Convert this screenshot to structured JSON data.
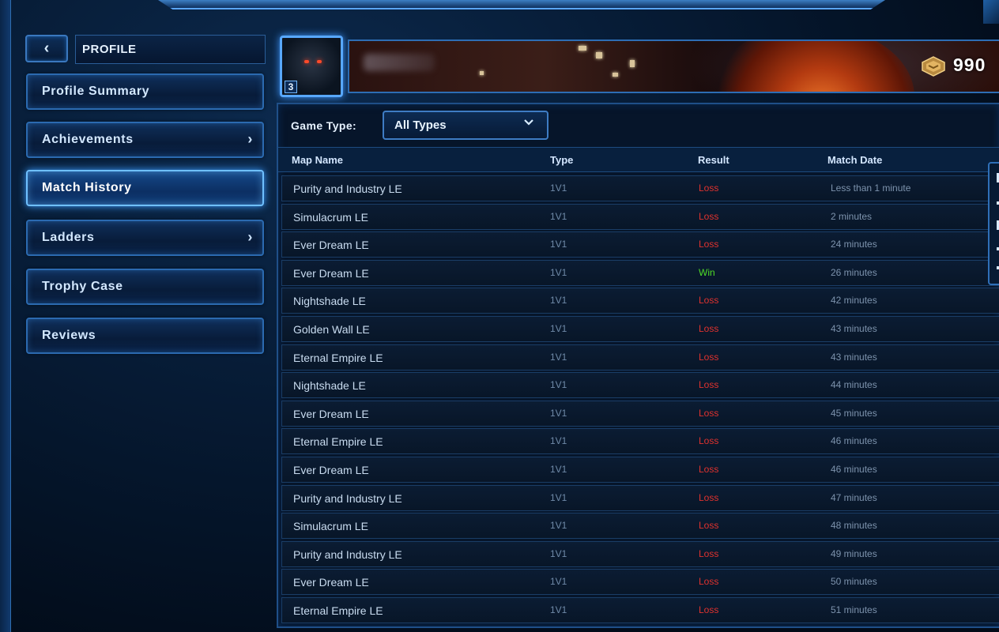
{
  "sidebar": {
    "back_icon": "chevron-left-icon",
    "title": "PROFILE",
    "items": [
      {
        "label": "Profile Summary",
        "has_chevron": false
      },
      {
        "label": "Achievements",
        "has_chevron": true
      },
      {
        "label": "Match History",
        "has_chevron": false,
        "active": true
      },
      {
        "label": "Ladders",
        "has_chevron": true
      },
      {
        "label": "Trophy Case",
        "has_chevron": false
      },
      {
        "label": "Reviews",
        "has_chevron": false
      }
    ],
    "chevron_glyph": "›"
  },
  "header": {
    "portrait_level": "3",
    "points": "990"
  },
  "filter": {
    "label": "Game Type:",
    "selected": "All Types",
    "chevron_glyph": "⌄"
  },
  "table": {
    "columns": [
      "Map Name",
      "Type",
      "Result",
      "Match Date"
    ],
    "rows": [
      {
        "map": "Purity and Industry LE",
        "type": "1V1",
        "result": "Loss",
        "date": "Less than 1 minute"
      },
      {
        "map": "Simulacrum LE",
        "type": "1V1",
        "result": "Loss",
        "date": "2 minutes"
      },
      {
        "map": "Ever Dream LE",
        "type": "1V1",
        "result": "Loss",
        "date": "24 minutes"
      },
      {
        "map": "Ever Dream LE",
        "type": "1V1",
        "result": "Win",
        "date": "26 minutes"
      },
      {
        "map": "Nightshade LE",
        "type": "1V1",
        "result": "Loss",
        "date": "42 minutes"
      },
      {
        "map": "Golden Wall LE",
        "type": "1V1",
        "result": "Loss",
        "date": "43 minutes"
      },
      {
        "map": "Eternal Empire LE",
        "type": "1V1",
        "result": "Loss",
        "date": "43 minutes"
      },
      {
        "map": "Nightshade LE",
        "type": "1V1",
        "result": "Loss",
        "date": "44 minutes"
      },
      {
        "map": "Ever Dream LE",
        "type": "1V1",
        "result": "Loss",
        "date": "45 minutes"
      },
      {
        "map": "Eternal Empire LE",
        "type": "1V1",
        "result": "Loss",
        "date": "46 minutes"
      },
      {
        "map": "Ever Dream LE",
        "type": "1V1",
        "result": "Loss",
        "date": "46 minutes"
      },
      {
        "map": "Purity and Industry LE",
        "type": "1V1",
        "result": "Loss",
        "date": "47 minutes"
      },
      {
        "map": "Simulacrum LE",
        "type": "1V1",
        "result": "Loss",
        "date": "48 minutes"
      },
      {
        "map": "Purity and Industry LE",
        "type": "1V1",
        "result": "Loss",
        "date": "49 minutes"
      },
      {
        "map": "Ever Dream LE",
        "type": "1V1",
        "result": "Loss",
        "date": "50 minutes"
      },
      {
        "map": "Eternal Empire LE",
        "type": "1V1",
        "result": "Loss",
        "date": "51 minutes"
      }
    ]
  },
  "colors": {
    "loss": "#e0322e",
    "win": "#4fdc27",
    "accent": "#3b9cff"
  }
}
